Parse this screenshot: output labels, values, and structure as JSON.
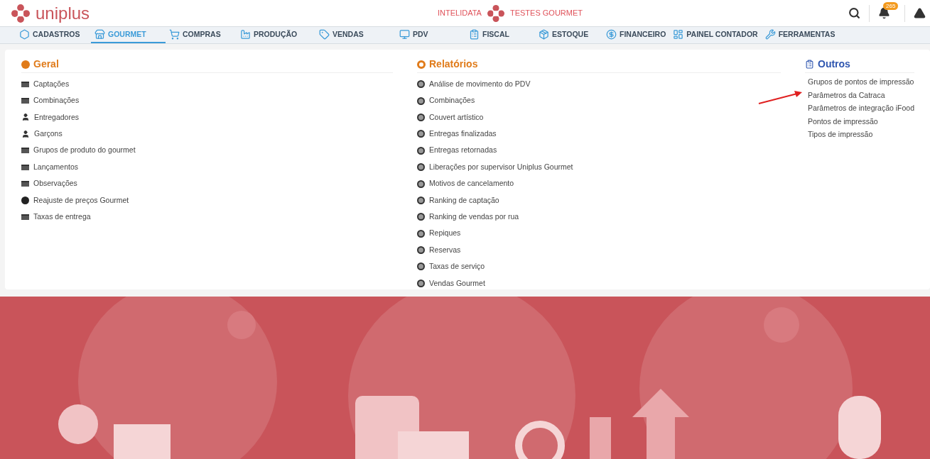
{
  "header": {
    "brand": "uniplus",
    "company": "INTELIDATA",
    "environment": "TESTES GOURMET",
    "notifications_badge": "265"
  },
  "nav": [
    {
      "label": "CADASTROS",
      "selected": false
    },
    {
      "label": "GOURMET",
      "selected": true
    },
    {
      "label": "COMPRAS",
      "selected": false
    },
    {
      "label": "PRODUÇÃO",
      "selected": false
    },
    {
      "label": "VENDAS",
      "selected": false
    },
    {
      "label": "PDV",
      "selected": false
    },
    {
      "label": "FISCAL",
      "selected": false
    },
    {
      "label": "ESTOQUE",
      "selected": false
    },
    {
      "label": "FINANCEIRO",
      "selected": false
    },
    {
      "label": "PAINEL CONTADOR",
      "selected": false
    },
    {
      "label": "FERRAMENTAS",
      "selected": false
    }
  ],
  "sections": [
    {
      "title": "Geral",
      "kind": "geral",
      "items": [
        {
          "label": "Captações",
          "kind": "list"
        },
        {
          "label": "Combinações",
          "kind": "list"
        },
        {
          "label": "Entregadores",
          "kind": "person"
        },
        {
          "label": "Garçons",
          "kind": "person"
        },
        {
          "label": "Grupos de produto do gourmet",
          "kind": "list"
        },
        {
          "label": "Lançamentos",
          "kind": "list"
        },
        {
          "label": "Observações",
          "kind": "list"
        },
        {
          "label": "Reajuste de preços Gourmet",
          "kind": "dollar"
        },
        {
          "label": "Taxas de entrega",
          "kind": "list"
        }
      ]
    },
    {
      "title": "Relatórios",
      "kind": "relatorios",
      "items": [
        {
          "label": "Análise de movimento do PDV",
          "kind": "report"
        },
        {
          "label": "Combinações",
          "kind": "report"
        },
        {
          "label": "Couvert artístico",
          "kind": "report"
        },
        {
          "label": "Entregas finalizadas",
          "kind": "report"
        },
        {
          "label": "Entregas retornadas",
          "kind": "report"
        },
        {
          "label": "Liberações por supervisor Uniplus Gourmet",
          "kind": "report"
        },
        {
          "label": "Motivos de cancelamento",
          "kind": "report"
        },
        {
          "label": "Ranking de captação",
          "kind": "report"
        },
        {
          "label": "Ranking de vendas por rua",
          "kind": "report"
        },
        {
          "label": "Repiques",
          "kind": "report"
        },
        {
          "label": "Reservas",
          "kind": "report"
        },
        {
          "label": "Taxas de serviço",
          "kind": "report"
        },
        {
          "label": "Vendas Gourmet",
          "kind": "report"
        }
      ]
    },
    {
      "title": "Outros",
      "kind": "outros",
      "items": [
        {
          "label": "Grupos de pontos de impressão",
          "kind": "plain"
        },
        {
          "label": "Parâmetros da Catraca",
          "kind": "plain"
        },
        {
          "label": "Parâmetros de integração iFood",
          "kind": "plain"
        },
        {
          "label": "Pontos de impressão",
          "kind": "plain"
        },
        {
          "label": "Tipos de impressão",
          "kind": "plain"
        }
      ]
    }
  ]
}
